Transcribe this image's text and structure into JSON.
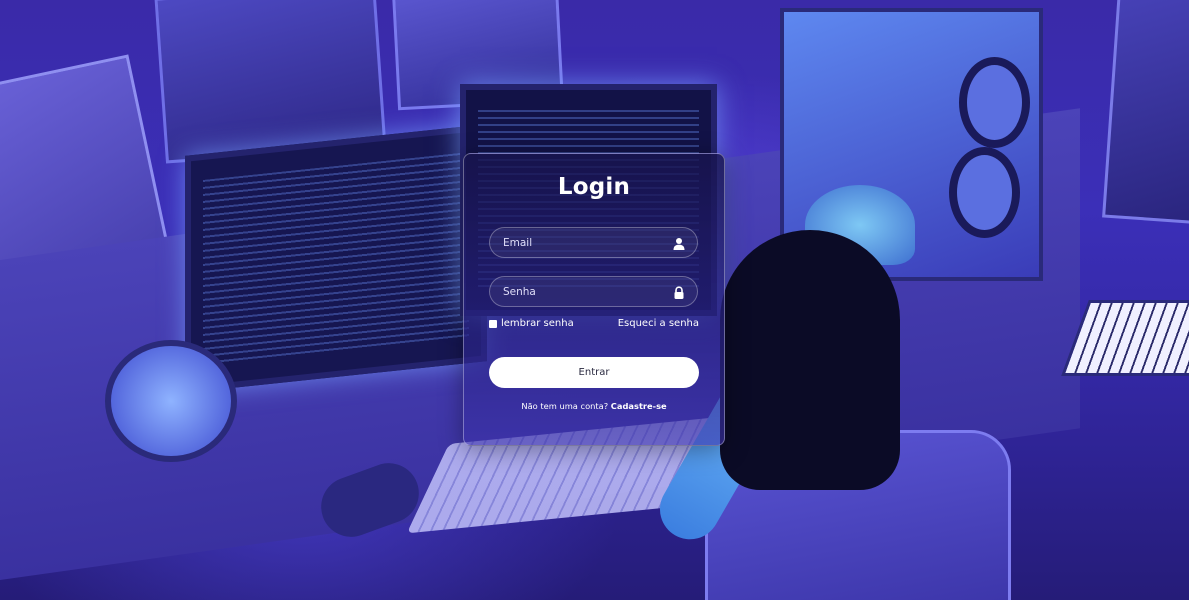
{
  "login": {
    "title": "Login",
    "email_placeholder": "Email",
    "password_placeholder": "Senha",
    "remember_label": "lembrar senha",
    "forgot_label": "Esqueci a senha",
    "submit_label": "Entrar",
    "register_prompt": "Não tem uma conta?",
    "register_link": "Cadastre-se"
  },
  "icons": {
    "email_field": "user-icon",
    "password_field": "lock-icon"
  },
  "colors": {
    "card_background": "#1e1a5e",
    "button_background": "#ffffff",
    "text": "#ffffff"
  }
}
